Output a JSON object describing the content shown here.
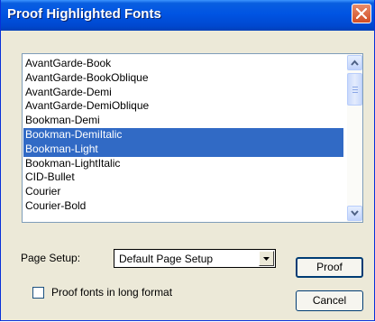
{
  "window": {
    "title": "Proof Highlighted Fonts"
  },
  "font_list": {
    "items": [
      {
        "label": "AvantGarde-Book",
        "selected": false
      },
      {
        "label": "AvantGarde-BookOblique",
        "selected": false
      },
      {
        "label": "AvantGarde-Demi",
        "selected": false
      },
      {
        "label": "AvantGarde-DemiOblique",
        "selected": false
      },
      {
        "label": "Bookman-Demi",
        "selected": false
      },
      {
        "label": "Bookman-DemiItalic",
        "selected": true
      },
      {
        "label": "Bookman-Light",
        "selected": true
      },
      {
        "label": "Bookman-LightItalic",
        "selected": false
      },
      {
        "label": "CID-Bullet",
        "selected": false
      },
      {
        "label": "Courier",
        "selected": false
      },
      {
        "label": "Courier-Bold",
        "selected": false
      }
    ]
  },
  "page_setup": {
    "label": "Page Setup:",
    "value": "Default Page Setup"
  },
  "options": {
    "long_format_label": "Proof fonts in long format",
    "long_format_checked": false
  },
  "buttons": {
    "proof": "Proof",
    "cancel": "Cancel"
  }
}
